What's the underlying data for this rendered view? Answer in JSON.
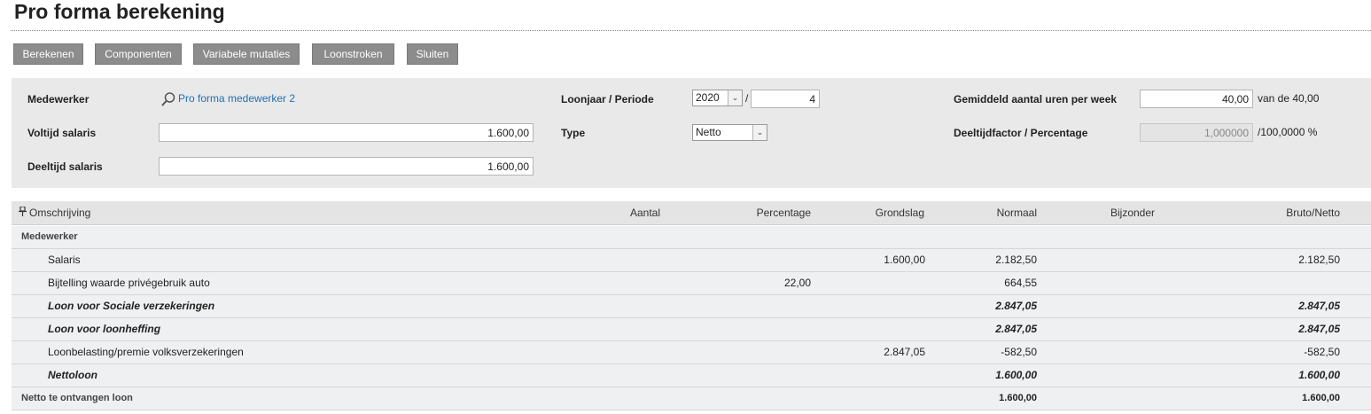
{
  "page": {
    "title": "Pro forma berekening"
  },
  "toolbar": {
    "berekenen": "Berekenen",
    "componenten": "Componenten",
    "variabele_mutaties": "Variabele mutaties",
    "loonstroken": "Loonstroken",
    "sluiten": "Sluiten"
  },
  "form": {
    "medewerker_label": "Medewerker",
    "medewerker_value": "Pro forma medewerker 2",
    "voltijd_label": "Voltijd salaris",
    "voltijd_value": "1.600,00",
    "deeltijd_label": "Deeltijd salaris",
    "deeltijd_value": "1.600,00",
    "loonjaar_label": "Loonjaar / Periode",
    "loonjaar_value": "2020",
    "slash": "/",
    "periode_value": "4",
    "type_label": "Type",
    "type_value": "Netto",
    "uren_label": "Gemiddeld aantal uren per week",
    "uren_value": "40,00",
    "uren_suffix": "van de 40,00",
    "deeltijdfactor_label": "Deeltijdfactor / Percentage",
    "deeltijdfactor_value": "1,000000",
    "deeltijdfactor_suffix": "/100,0000 %"
  },
  "table": {
    "headers": {
      "omschrijving": "Omschrijving",
      "aantal": "Aantal",
      "percentage": "Percentage",
      "grondslag": "Grondslag",
      "normaal": "Normaal",
      "bijzonder": "Bijzonder",
      "bruto_netto": "Bruto/Netto"
    },
    "rows": [
      {
        "label": "Medewerker",
        "percentage": "",
        "grondslag": "",
        "normaal": "",
        "bruto_netto": ""
      },
      {
        "label": "Salaris",
        "percentage": "",
        "grondslag": "1.600,00",
        "normaal": "2.182,50",
        "bruto_netto": "2.182,50"
      },
      {
        "label": "Bijtelling waarde privégebruik auto",
        "percentage": "22,00",
        "grondslag": "",
        "normaal": "664,55",
        "bruto_netto": ""
      },
      {
        "label": "Loon voor Sociale verzekeringen",
        "percentage": "",
        "grondslag": "",
        "normaal": "2.847,05",
        "bruto_netto": "2.847,05"
      },
      {
        "label": "Loon voor loonheffing",
        "percentage": "",
        "grondslag": "",
        "normaal": "2.847,05",
        "bruto_netto": "2.847,05"
      },
      {
        "label": "Loonbelasting/premie volksverzekeringen",
        "percentage": "",
        "grondslag": "2.847,05",
        "normaal": "-582,50",
        "bruto_netto": "-582,50"
      },
      {
        "label": "Nettoloon",
        "percentage": "",
        "grondslag": "",
        "normaal": "1.600,00",
        "bruto_netto": "1.600,00"
      },
      {
        "label": "Netto te ontvangen loon",
        "percentage": "",
        "grondslag": "",
        "normaal": "1.600,00",
        "bruto_netto": "1.600,00"
      }
    ]
  },
  "colors": {
    "button_bg": "#8c8c8c",
    "panel_bg": "#e9e9e9",
    "link": "#1f6fb2",
    "row_bg": "#eef0f1"
  },
  "icons": {
    "medewerker_lookup": "magnifier-icon",
    "column_pin": "pin-icon"
  }
}
